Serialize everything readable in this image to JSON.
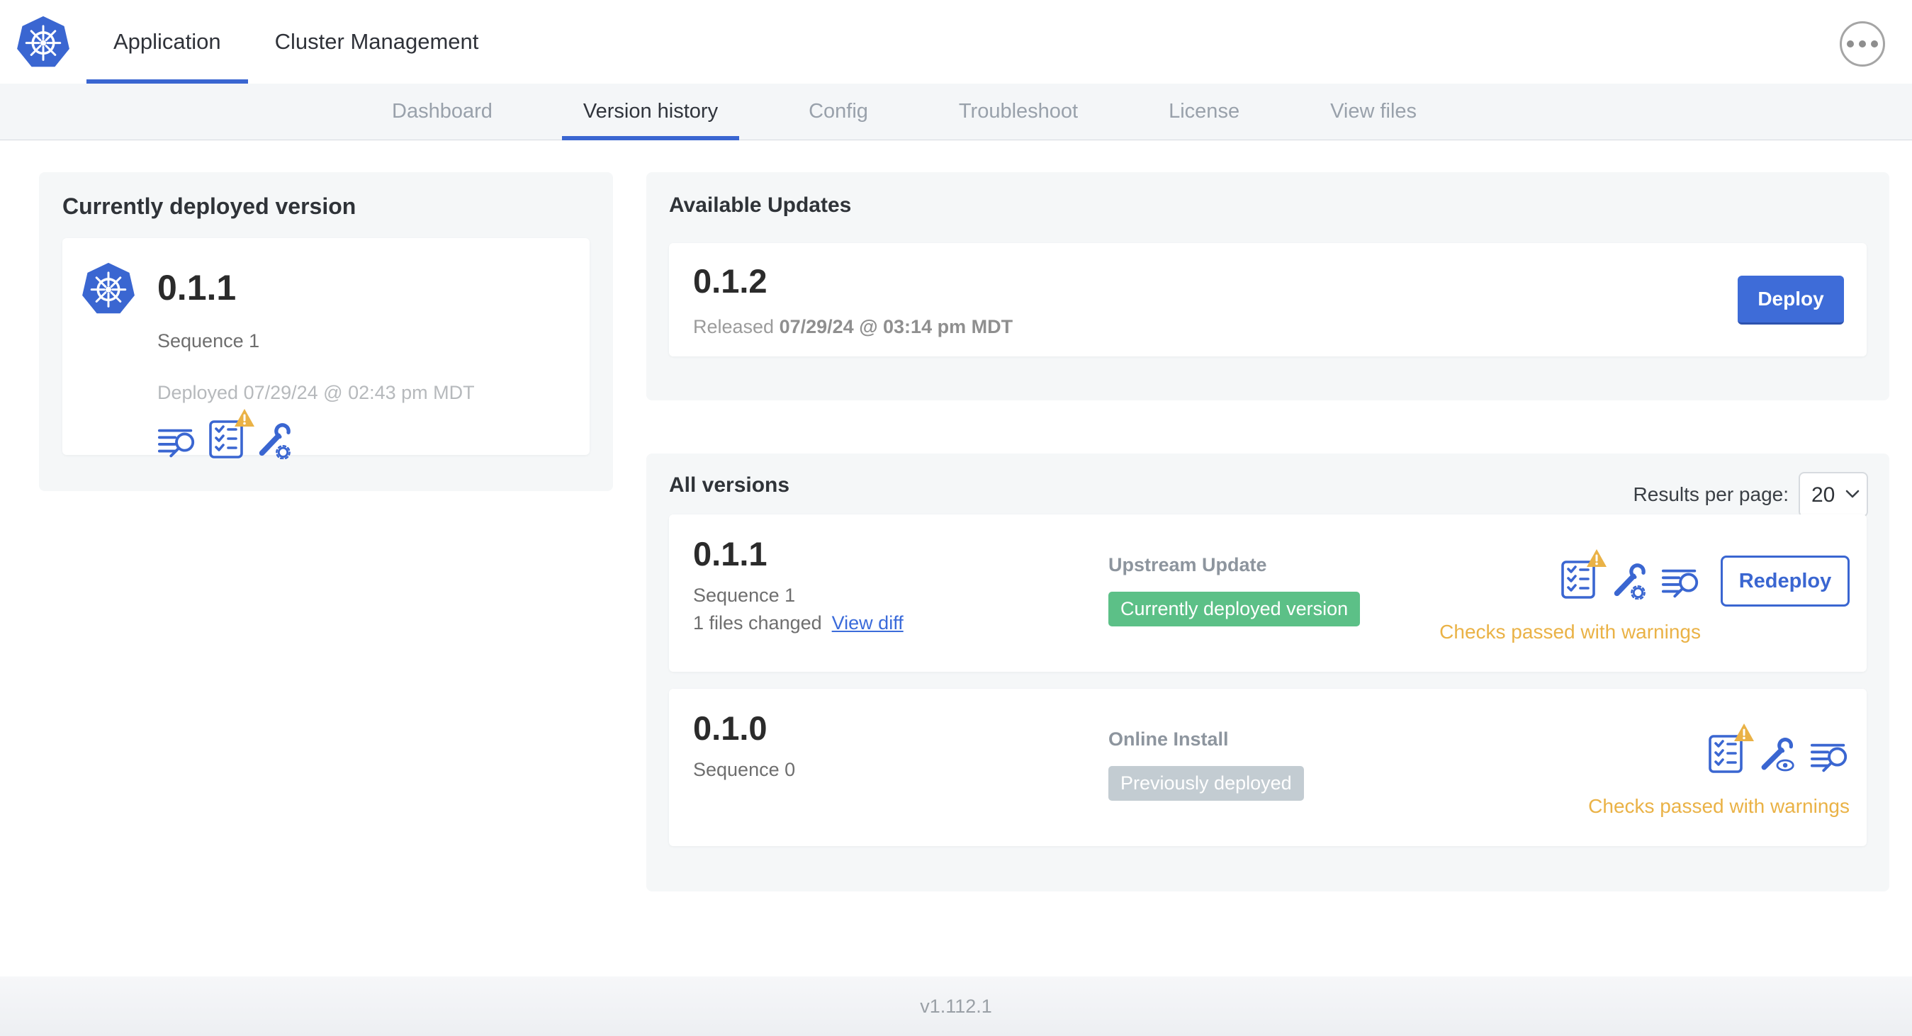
{
  "app": {
    "footer_version": "v1.112.1"
  },
  "header": {
    "logo": "kubernetes-logo",
    "tabs": [
      {
        "label": "Application"
      },
      {
        "label": "Cluster Management"
      }
    ],
    "active_tab": "Application",
    "menu_icon": "ellipsis-icon"
  },
  "subnav": {
    "tabs": [
      {
        "label": "Dashboard"
      },
      {
        "label": "Version history"
      },
      {
        "label": "Config"
      },
      {
        "label": "Troubleshoot"
      },
      {
        "label": "License"
      },
      {
        "label": "View files"
      }
    ],
    "active_tab": "Version history"
  },
  "current_version": {
    "title": "Currently deployed version",
    "version": "0.1.1",
    "sequence": "Sequence 1",
    "deployed_at": "Deployed 07/29/24 @ 02:43 pm MDT",
    "icons": [
      "release-notes-icon",
      "preflight-checks-warning-icon",
      "edit-config-icon"
    ]
  },
  "available_updates": {
    "title": "Available Updates",
    "update": {
      "version": "0.1.2",
      "released_label": "Released",
      "released_at": "07/29/24 @ 03:14 pm MDT",
      "deploy_label": "Deploy"
    }
  },
  "all_versions": {
    "title": "All versions",
    "results_per_page_label": "Results per page:",
    "results_per_page_value": "20",
    "rows": [
      {
        "version": "0.1.1",
        "sequence": "Sequence 1",
        "files_changed": "1 files changed",
        "view_diff_label": "View diff",
        "source": "Upstream Update",
        "badge": "Currently deployed version",
        "badge_style": "green",
        "status": "Checks passed with warnings",
        "action_label": "Redeploy",
        "icons": [
          "preflight-checks-warning-icon",
          "edit-config-icon",
          "release-notes-icon"
        ]
      },
      {
        "version": "0.1.0",
        "sequence": "Sequence 0",
        "source": "Online Install",
        "badge": "Previously deployed",
        "badge_style": "gray",
        "status": "Checks passed with warnings",
        "icons": [
          "preflight-checks-warning-icon",
          "view-config-icon",
          "release-notes-icon"
        ]
      }
    ]
  },
  "colors": {
    "primary_blue": "#3a66d1",
    "button_blue": "#3e6cd8",
    "link_blue": "#3b6bda",
    "badge_green": "#5cc087",
    "badge_gray": "#c3ccd2",
    "warning_orange": "#eab246",
    "subnav_background": "#f4f6f8",
    "card_background": "#f5f7f8"
  }
}
